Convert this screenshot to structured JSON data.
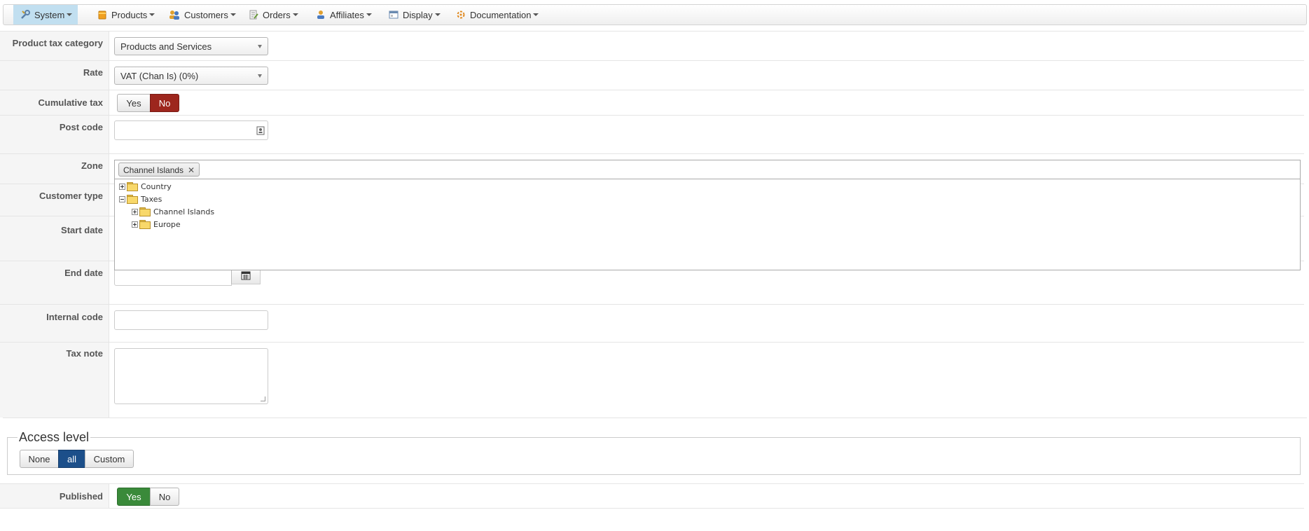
{
  "nav": {
    "items": [
      {
        "label": "System",
        "icon": "tools-icon"
      },
      {
        "label": "Products",
        "icon": "products-icon"
      },
      {
        "label": "Customers",
        "icon": "customers-icon"
      },
      {
        "label": "Orders",
        "icon": "orders-icon"
      },
      {
        "label": "Affiliates",
        "icon": "affiliates-icon"
      },
      {
        "label": "Display",
        "icon": "display-icon"
      },
      {
        "label": "Documentation",
        "icon": "documentation-icon"
      }
    ],
    "active": "System"
  },
  "form": {
    "product_tax_category": {
      "label": "Product tax category",
      "value": "Products and Services"
    },
    "rate": {
      "label": "Rate",
      "value": "VAT (Chan Is) (0%)"
    },
    "cumulative_tax": {
      "label": "Cumulative tax",
      "yes": "Yes",
      "no": "No",
      "selected": "No"
    },
    "post_code": {
      "label": "Post code",
      "value": ""
    },
    "zone": {
      "label": "Zone",
      "selected_tag": "Channel Islands",
      "remove": "✕"
    },
    "zone_tree": {
      "nodes": [
        {
          "label": "Country",
          "state": "collapsed"
        },
        {
          "label": "Taxes",
          "state": "expanded",
          "children": [
            {
              "label": "Channel Islands",
              "state": "collapsed"
            },
            {
              "label": "Europe",
              "state": "collapsed"
            }
          ]
        }
      ]
    },
    "customer_type": {
      "label": "Customer type"
    },
    "start_date": {
      "label": "Start date"
    },
    "end_date": {
      "label": "End date",
      "value": ""
    },
    "internal_code": {
      "label": "Internal code",
      "value": ""
    },
    "tax_note": {
      "label": "Tax note",
      "value": ""
    }
  },
  "access_level": {
    "legend": "Access level",
    "options": [
      "None",
      "all",
      "Custom"
    ],
    "selected": "all"
  },
  "published": {
    "label": "Published",
    "yes": "Yes",
    "no": "No",
    "selected": "Yes"
  },
  "colors": {
    "active_nav": "#c1dff0",
    "no_selected": "#9d261d",
    "all_selected": "#1c4f8a",
    "yes_selected": "#3a8a3a"
  }
}
